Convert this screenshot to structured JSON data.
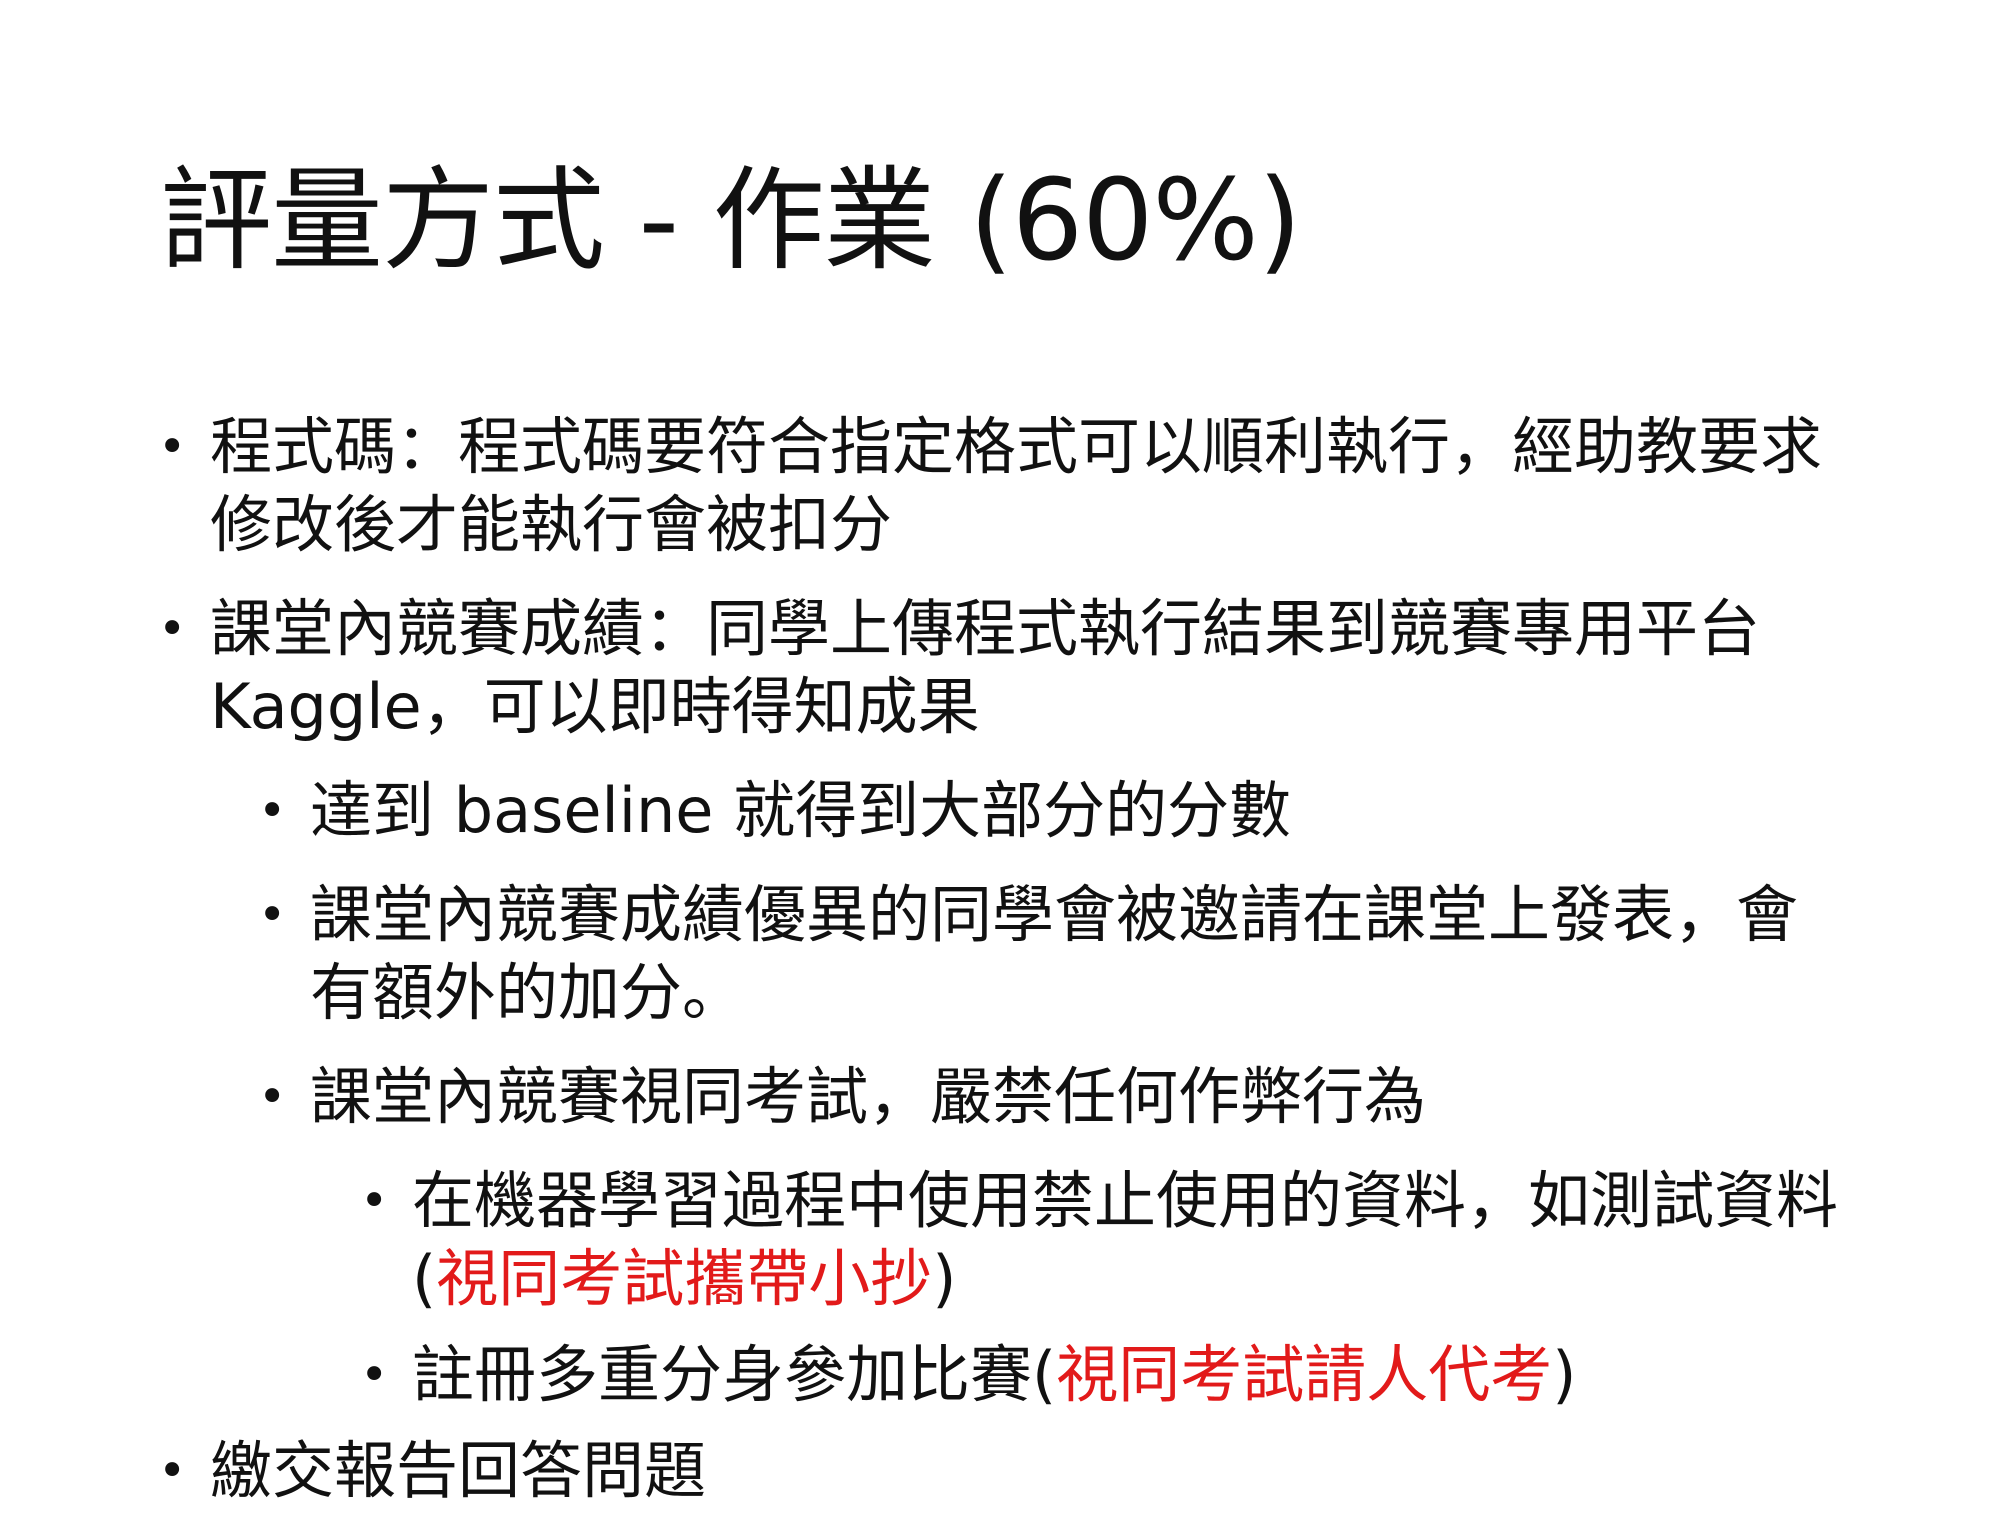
{
  "slide": {
    "title": "評量方式 - 作業 (60%)",
    "items": [
      {
        "level": 1,
        "text": "程式碼：程式碼要符合指定格式可以順利執行，經助教要求修改後才能執行會被扣分"
      },
      {
        "level": 1,
        "text": "課堂內競賽成績：同學上傳程式執行結果到競賽專用平台 Kaggle，可以即時得知成果"
      },
      {
        "level": 2,
        "text": "達到 baseline 就得到大部分的分數"
      },
      {
        "level": 2,
        "text": "課堂內競賽成績優異的同學會被邀請在課堂上發表，會有額外的加分。"
      },
      {
        "level": 2,
        "text": "課堂內競賽視同考試，嚴禁任何作弊行為"
      },
      {
        "level": 3,
        "text": "在機器學習過程中使用禁止使用的資料，如測試資料(",
        "highlight": "視同考試攜帶小抄",
        "suffix": ")"
      },
      {
        "level": 3,
        "text": "註冊多重分身參加比賽(",
        "highlight": "視同考試請人代考",
        "suffix": ")"
      },
      {
        "level": 1,
        "text": "繳交報告回答問題"
      }
    ],
    "bullet_glyph": "•",
    "highlight_color": "#e21a1a"
  }
}
